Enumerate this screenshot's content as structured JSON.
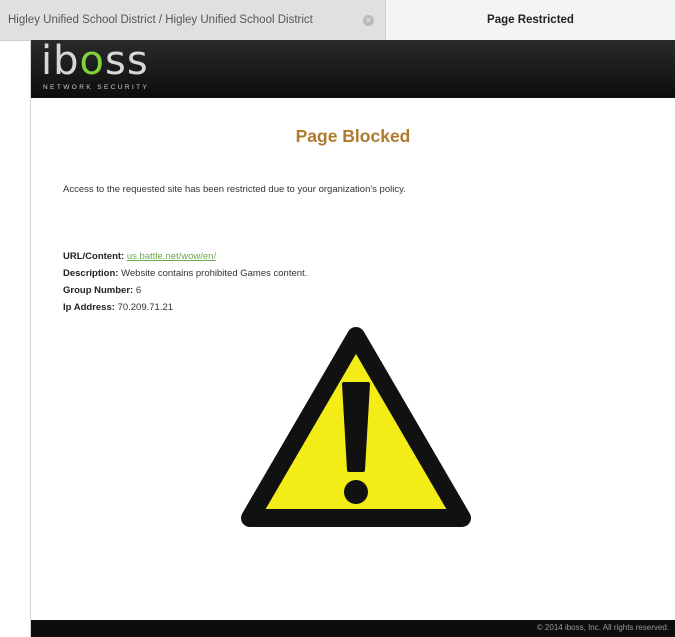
{
  "browser": {
    "tabs": [
      {
        "label": "Higley Unified School District / Higley Unified School District",
        "active": false
      },
      {
        "label": "Page Restricted",
        "active": true
      }
    ],
    "close_icon": "close-icon"
  },
  "header": {
    "logo_text": "iboss",
    "logo_subtitle": "NETWORK SECURITY",
    "accent_color": "#7fd23a"
  },
  "page": {
    "title": "Page Blocked",
    "title_color": "#b07a2c",
    "message": "Access to the requested site has been restricted due to your organization's policy.",
    "details": {
      "url_label": "URL/Content:",
      "url_value": "us.battle.net/wow/en/",
      "description_label": "Description:",
      "description_value": "Website contains prohibited Games content.",
      "group_label": "Group Number:",
      "group_value": "6",
      "ip_label": "Ip Address:",
      "ip_value": "70.209.71.21"
    },
    "warning_icon": "warning-triangle-icon"
  },
  "footer": {
    "copyright": "© 2014 iboss, Inc. All rights reserved."
  }
}
